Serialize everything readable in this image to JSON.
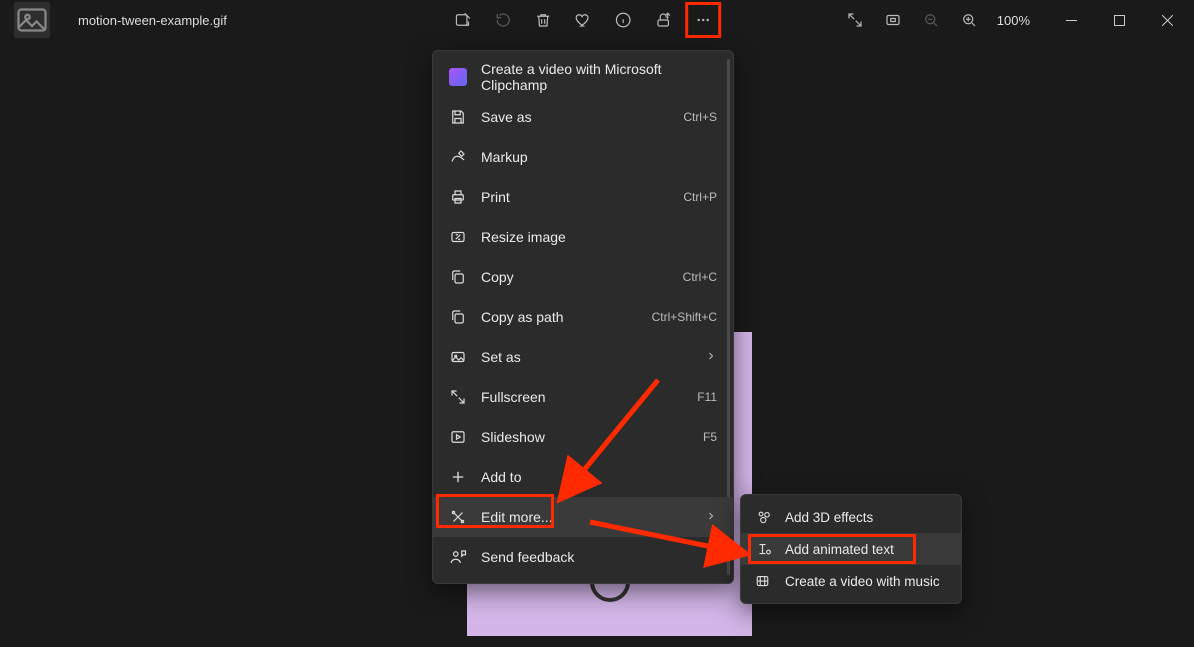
{
  "file_name": "motion-tween-example.gif",
  "zoom_label": "100%",
  "menu": {
    "items": [
      {
        "label": "Create a video with Microsoft Clipchamp"
      },
      {
        "label": "Save as",
        "shortcut": "Ctrl+S"
      },
      {
        "label": "Markup"
      },
      {
        "label": "Print",
        "shortcut": "Ctrl+P"
      },
      {
        "label": "Resize image"
      },
      {
        "label": "Copy",
        "shortcut": "Ctrl+C"
      },
      {
        "label": "Copy as path",
        "shortcut": "Ctrl+Shift+C"
      },
      {
        "label": "Set as"
      },
      {
        "label": "Fullscreen",
        "shortcut": "F11"
      },
      {
        "label": "Slideshow",
        "shortcut": "F5"
      },
      {
        "label": "Add to"
      },
      {
        "label": "Edit more..."
      },
      {
        "label": "Send feedback"
      }
    ]
  },
  "submenu": {
    "items": [
      {
        "label": "Add 3D effects"
      },
      {
        "label": "Add animated text"
      },
      {
        "label": "Create a video with music"
      }
    ]
  }
}
